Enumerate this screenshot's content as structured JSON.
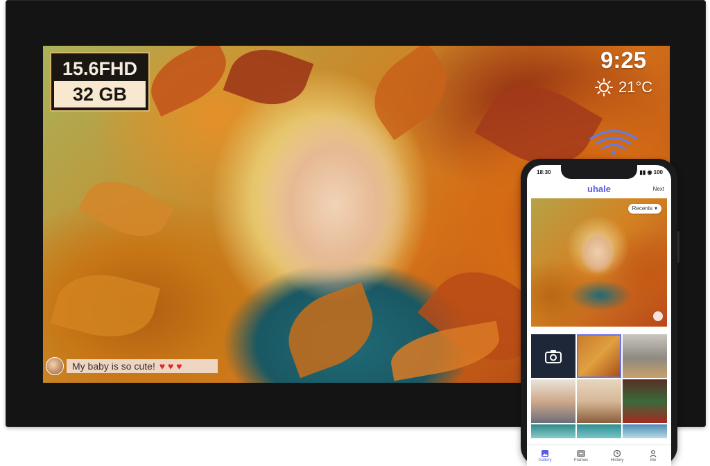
{
  "frame": {
    "badge": {
      "resolution": "15.6FHD",
      "storage": "32 GB"
    },
    "clock": "9:25",
    "weather": {
      "icon": "sun-icon",
      "temperature": "21°C"
    },
    "caption": {
      "message": "My baby is so cute!",
      "hearts": "♥ ♥ ♥"
    },
    "colors": {
      "badge_border": "#d8b56a",
      "heart": "#e0282d"
    }
  },
  "phone": {
    "status_time": "18:30",
    "status_icons": "▮▮ ◉ 100",
    "app_logo": "uhale",
    "next_label": "Next",
    "recents_label": "Recents",
    "tabs": [
      {
        "label": "Gallery",
        "icon": "gallery-icon",
        "active": true
      },
      {
        "label": "Frames",
        "icon": "frames-icon",
        "active": false
      },
      {
        "label": "History",
        "icon": "history-icon",
        "active": false
      },
      {
        "label": "Me",
        "icon": "person-icon",
        "active": false
      }
    ],
    "colors": {
      "accent": "#5a5ce6"
    }
  }
}
